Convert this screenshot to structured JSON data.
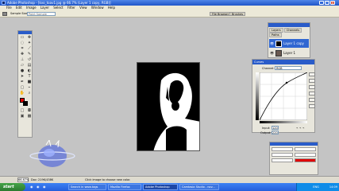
{
  "window": {
    "title": "Adobe Photoshop - [kvo_toav1.jpg @ 66.7% (Layer 1 copy, RGB)]"
  },
  "menu": [
    "File",
    "Edit",
    "Image",
    "Layer",
    "Select",
    "Filter",
    "View",
    "Window",
    "Help"
  ],
  "options": {
    "sample_label": "Sample Size:",
    "sample_value": "Point Sample"
  },
  "wells": [
    "File Browser",
    "Brushes"
  ],
  "layers": {
    "tabs": [
      "Layers",
      "Channels",
      "Paths"
    ],
    "items": [
      "Layer 1 copy",
      "Layer 1"
    ]
  },
  "curves": {
    "title": "Curves",
    "channel_label": "Channel:",
    "channel_value": "RGB",
    "input_label": "Input:",
    "input_value": "120",
    "output_label": "Output:",
    "output_value": "220"
  },
  "status": {
    "zoom": "66.67%",
    "doc": "Doc: 219K/438K",
    "hint": "Click image to choose new color."
  },
  "taskbar": {
    "start": "start",
    "tasks": [
      "Search in www.tags",
      "Mozilla Firefox",
      "Adobe Photoshop",
      "Camtasia Studio - nov..."
    ],
    "tray_lang": "ENG",
    "clock": "14:09"
  },
  "colors": {
    "foreground": "#e00000",
    "background": "#000000"
  }
}
